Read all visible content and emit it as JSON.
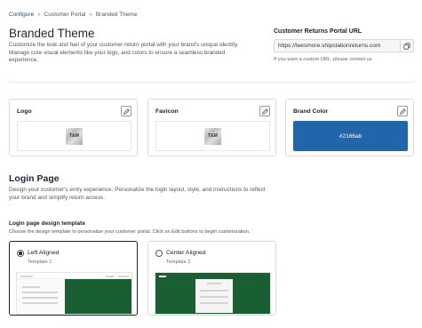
{
  "breadcrumb": {
    "items": [
      "Configure",
      "Customer Portal",
      "Branded Theme"
    ],
    "separator": "»"
  },
  "header": {
    "title": "Branded Theme",
    "description": "Customize the look and feel of your customer return portal with your brand's unique identity. Manage core visual elements like your logo, and colors to ensure a seamless branded experience."
  },
  "portal": {
    "label": "Customer Returns Portal URL",
    "url": "https://teesmore.shipstationreturns.com",
    "hint": "If you want a custom URL, please contact us"
  },
  "cards": {
    "logo": {
      "title": "Logo",
      "image_text": "T&M"
    },
    "favicon": {
      "title": "Favicon",
      "image_text": "T&M"
    },
    "brand_color": {
      "title": "Brand Color",
      "value": "#2166ab"
    }
  },
  "login": {
    "title": "Login Page",
    "description": "Design your customer's entry experience. Personalize the login layout, style, and instructions to reflect your brand and simplify return access.",
    "template_label": "Login page design template",
    "template_desc": "Choose the design template to personalize your customer portal. Click on Edit buttons to begin customization.",
    "templates": [
      {
        "name": "Left Aligned",
        "sub": "Template 1",
        "selected": true
      },
      {
        "name": "Center Aligned",
        "sub": "Template 2",
        "selected": false
      }
    ]
  },
  "colors": {
    "brand": "#2166ab",
    "preview_green": "#1a5e33",
    "breadcrumb_link": "#2a4e7a"
  },
  "icons": {
    "edit": "pencil-icon",
    "copy": "copy-icon",
    "separator": "chevron-double-right-icon"
  }
}
